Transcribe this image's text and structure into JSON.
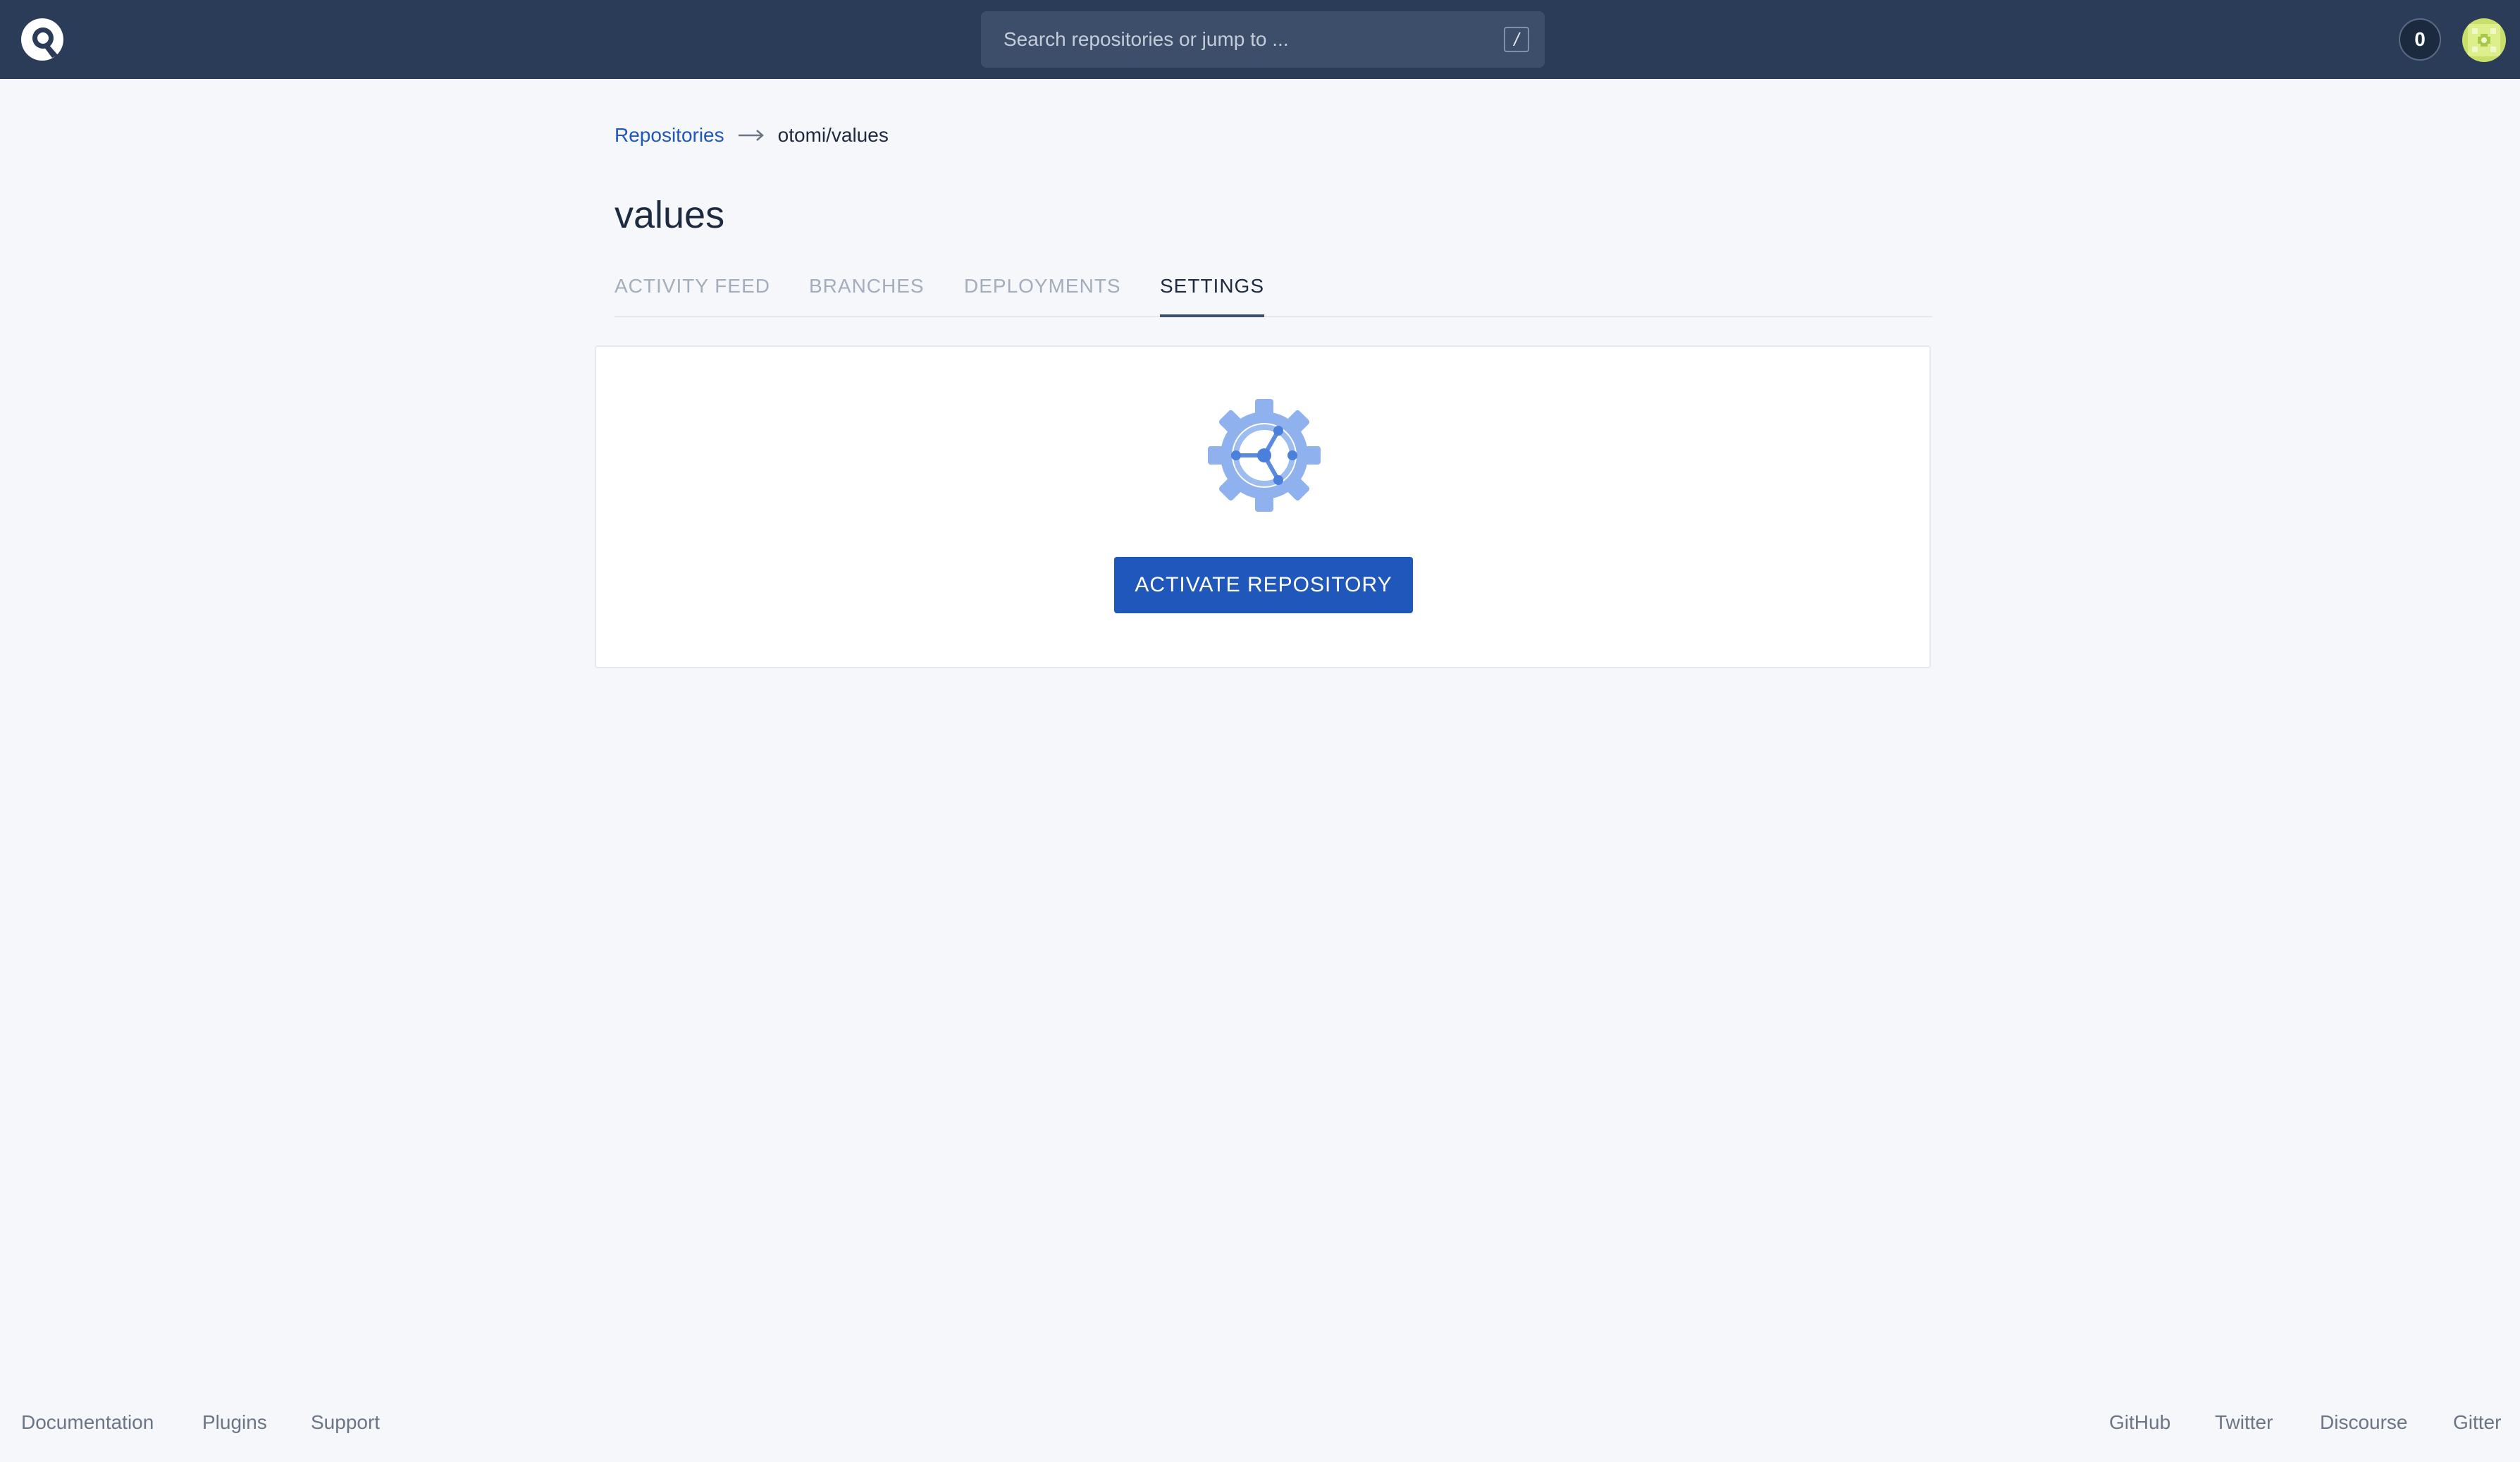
{
  "header": {
    "search_placeholder": "Search repositories or jump to ...",
    "search_shortcut": "/",
    "notification_count": "0"
  },
  "breadcrumb": {
    "root": "Repositories",
    "current": "otomi/values"
  },
  "page": {
    "title": "values"
  },
  "tabs": [
    {
      "label": "ACTIVITY FEED",
      "active": false
    },
    {
      "label": "BRANCHES",
      "active": false
    },
    {
      "label": "DEPLOYMENTS",
      "active": false
    },
    {
      "label": "SETTINGS",
      "active": true
    }
  ],
  "card": {
    "icon": "settings-gear-icon",
    "button_label": "ACTIVATE REPOSITORY"
  },
  "footer": {
    "left": [
      "Documentation",
      "Plugins",
      "Support"
    ],
    "right": [
      "GitHub",
      "Twitter",
      "Discourse",
      "Gitter"
    ]
  },
  "colors": {
    "header_bg": "#2a3c58",
    "page_bg": "#f5f7fa",
    "accent": "#2057bb",
    "gear_light": "#9dbcf0",
    "gear_dark": "#4a7fdb"
  }
}
